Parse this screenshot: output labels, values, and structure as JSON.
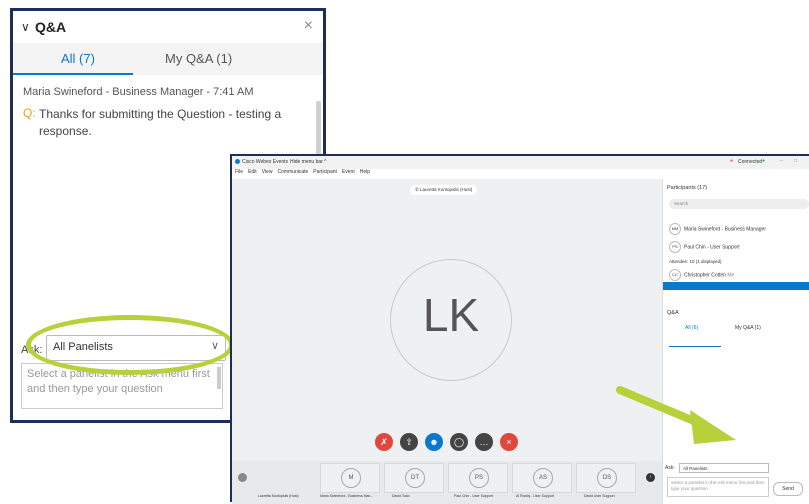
{
  "zoom_panel": {
    "title": "Q&A",
    "tabs": [
      "All (7)",
      "My Q&A (1)"
    ],
    "question_meta": "Maria Swineford - Business Manager - 7:41 AM",
    "question_prefix": "Q:",
    "question_text": "Thanks for submitting the Question - testing a response.",
    "ask_label": "Ask:",
    "ask_value": "All Panelists",
    "compose_placeholder": "Select a panelist in the Ask menu first and then type your question"
  },
  "webex": {
    "app_title": "Cisco Webex Events",
    "hide_menu": "Hide menu bar ^",
    "status": "Connected",
    "menu": [
      "File",
      "Edit",
      "View",
      "Communicate",
      "Participant",
      "Event",
      "Help"
    ],
    "presenter_tag": "Lauretta Kontopidis (Host)",
    "avatar_initials": "LK",
    "thumbs": [
      "M",
      "DT",
      "PS",
      "AS",
      "DS"
    ],
    "film_labels": [
      "Lauretta Kontopidis (Host)",
      "Maria Swineford - Business Man...",
      "David Todd",
      "Paul Chin - User Support",
      "Al Roddy - User Support",
      "David User Support"
    ],
    "participants_title": "Participants (17)",
    "search_placeholder": "Search",
    "panelists": [
      {
        "initials": "MM",
        "name": "Maria Swineford - Business Manager"
      },
      {
        "initials": "PS",
        "name": "Paul Chin - User Support"
      }
    ],
    "attendee_header": "Attendee: 10 (1 displayed)",
    "attendee": {
      "initials": "CC",
      "name": "Christopher Cotten",
      "sub": "Me"
    },
    "qa_title": "Q&A",
    "qa_tabs": [
      "All (6)",
      "My Q&A (1)"
    ],
    "ask_label": "Ask:",
    "ask_value": "All Panelists",
    "compose_placeholder": "Select a panelist in the Ask menu first and then type your question",
    "send_label": "Send"
  },
  "colors": {
    "accent": "#0a78cc",
    "highlight": "#b7d13a",
    "frame": "#1f2d5a"
  }
}
